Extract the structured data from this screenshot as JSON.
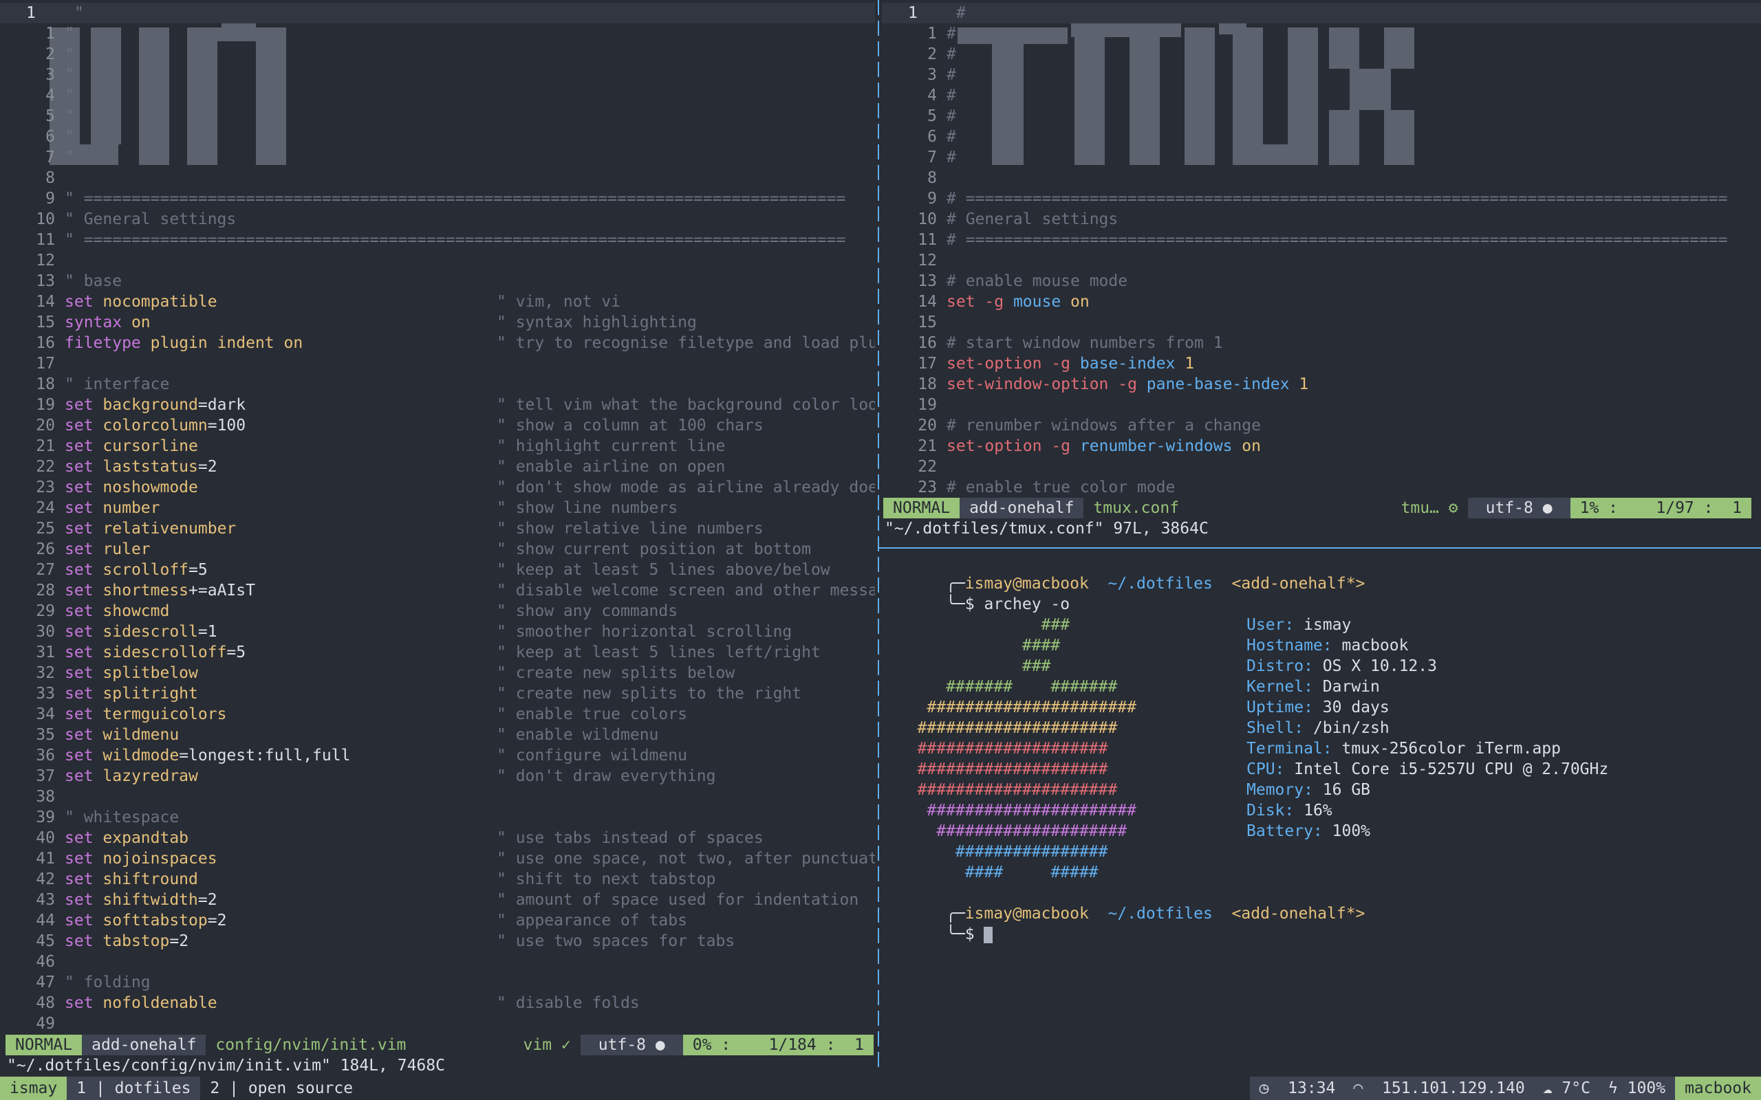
{
  "left_buffer": {
    "current_line": "1",
    "lines": [
      {
        "n": "1",
        "t": "\"",
        "c": "cmt"
      },
      {
        "n": "1",
        "t": "\"",
        "c": "cmt"
      },
      {
        "n": "2",
        "t": "\"",
        "c": "cmt"
      },
      {
        "n": "3",
        "t": "\"",
        "c": "cmt"
      },
      {
        "n": "4",
        "t": "\"",
        "c": "cmt"
      },
      {
        "n": "5",
        "t": "\"",
        "c": "cmt"
      },
      {
        "n": "6",
        "t": "\"",
        "c": "cmt"
      },
      {
        "n": "7",
        "t": "\"",
        "c": "cmt"
      },
      {
        "n": "8",
        "t": "",
        "c": "cmt"
      },
      {
        "n": "9",
        "t": "\" ================================================================================",
        "c": "cmt"
      },
      {
        "n": "10",
        "t": "\" General settings",
        "c": "cmt"
      },
      {
        "n": "11",
        "t": "\" ================================================================================",
        "c": "cmt"
      },
      {
        "n": "12",
        "t": "",
        "c": "cmt"
      },
      {
        "n": "13",
        "t": "\" base",
        "c": "cmt"
      },
      {
        "n": "14",
        "kw": "set",
        "opt": "nocompatible",
        "v": "",
        "cm": "\" vim, not vi"
      },
      {
        "n": "15",
        "kw": "syntax",
        "opt": "on",
        "v": "",
        "cm": "\" syntax highlighting"
      },
      {
        "n": "16",
        "kw": "filetype",
        "opt": "plugin indent on",
        "v": "",
        "cm": "\" try to recognise filetype and load plugins a"
      },
      {
        "n": "17",
        "t": "",
        "c": "cmt"
      },
      {
        "n": "18",
        "t": "\" interface",
        "c": "cmt"
      },
      {
        "n": "19",
        "kw": "set",
        "opt": "background",
        "v": "=dark",
        "cm": "\" tell vim what the background color looks lik"
      },
      {
        "n": "20",
        "kw": "set",
        "opt": "colorcolumn",
        "v": "=100",
        "cm": "\" show a column at 100 chars"
      },
      {
        "n": "21",
        "kw": "set",
        "opt": "cursorline",
        "v": "",
        "cm": "\" highlight current line"
      },
      {
        "n": "22",
        "kw": "set",
        "opt": "laststatus",
        "v": "=2",
        "cm": "\" enable airline on open"
      },
      {
        "n": "23",
        "kw": "set",
        "opt": "noshowmode",
        "v": "",
        "cm": "\" don't show mode as airline already does"
      },
      {
        "n": "24",
        "kw": "set",
        "opt": "number",
        "v": "",
        "cm": "\" show line numbers"
      },
      {
        "n": "25",
        "kw": "set",
        "opt": "relativenumber",
        "v": "",
        "cm": "\" show relative line numbers"
      },
      {
        "n": "26",
        "kw": "set",
        "opt": "ruler",
        "v": "",
        "cm": "\" show current position at bottom"
      },
      {
        "n": "27",
        "kw": "set",
        "opt": "scrolloff",
        "v": "=5",
        "cm": "\" keep at least 5 lines above/below"
      },
      {
        "n": "28",
        "kw": "set",
        "opt": "shortmess",
        "v": "+=aAIsT",
        "cm": "\" disable welcome screen and other messages"
      },
      {
        "n": "29",
        "kw": "set",
        "opt": "showcmd",
        "v": "",
        "cm": "\" show any commands"
      },
      {
        "n": "30",
        "kw": "set",
        "opt": "sidescroll",
        "v": "=1",
        "cm": "\" smoother horizontal scrolling"
      },
      {
        "n": "31",
        "kw": "set",
        "opt": "sidescrolloff",
        "v": "=5",
        "cm": "\" keep at least 5 lines left/right"
      },
      {
        "n": "32",
        "kw": "set",
        "opt": "splitbelow",
        "v": "",
        "cm": "\" create new splits below"
      },
      {
        "n": "33",
        "kw": "set",
        "opt": "splitright",
        "v": "",
        "cm": "\" create new splits to the right"
      },
      {
        "n": "34",
        "kw": "set",
        "opt": "termguicolors",
        "v": "",
        "cm": "\" enable true colors"
      },
      {
        "n": "35",
        "kw": "set",
        "opt": "wildmenu",
        "v": "",
        "cm": "\" enable wildmenu"
      },
      {
        "n": "36",
        "kw": "set",
        "opt": "wildmode",
        "v": "=longest:full,full",
        "cm": "\" configure wildmenu"
      },
      {
        "n": "37",
        "kw": "set",
        "opt": "lazyredraw",
        "v": "",
        "cm": "\" don't draw everything"
      },
      {
        "n": "38",
        "t": "",
        "c": "cmt"
      },
      {
        "n": "39",
        "t": "\" whitespace",
        "c": "cmt"
      },
      {
        "n": "40",
        "kw": "set",
        "opt": "expandtab",
        "v": "",
        "cm": "\" use tabs instead of spaces"
      },
      {
        "n": "41",
        "kw": "set",
        "opt": "nojoinspaces",
        "v": "",
        "cm": "\" use one space, not two, after punctuation"
      },
      {
        "n": "42",
        "kw": "set",
        "opt": "shiftround",
        "v": "",
        "cm": "\" shift to next tabstop"
      },
      {
        "n": "43",
        "kw": "set",
        "opt": "shiftwidth",
        "v": "=2",
        "cm": "\" amount of space used for indentation"
      },
      {
        "n": "44",
        "kw": "set",
        "opt": "softtabstop",
        "v": "=2",
        "cm": "\" appearance of tabs"
      },
      {
        "n": "45",
        "kw": "set",
        "opt": "tabstop",
        "v": "=2",
        "cm": "\" use two spaces for tabs"
      },
      {
        "n": "46",
        "t": "",
        "c": "cmt"
      },
      {
        "n": "47",
        "t": "\" folding",
        "c": "cmt"
      },
      {
        "n": "48",
        "kw": "set",
        "opt": "nofoldenable",
        "v": "",
        "cm": "\" disable folds"
      },
      {
        "n": "49",
        "t": "",
        "c": "cmt"
      }
    ],
    "status": {
      "mode": "NORMAL",
      "branch": "add-onehalf",
      "file": "config/nvim/init.vim",
      "filetype": "vim",
      "encoding": "utf-8",
      "percent": "0% :",
      "position": "1/184 :  1"
    },
    "cmdline": "\"~/.dotfiles/config/nvim/init.vim\" 184L, 7468C"
  },
  "right_buffer": {
    "lines": [
      {
        "n": "1",
        "t": "#",
        "c": "cmt"
      },
      {
        "n": "1",
        "t": "#",
        "c": "cmt"
      },
      {
        "n": "2",
        "t": "#",
        "c": "cmt"
      },
      {
        "n": "3",
        "t": "#",
        "c": "cmt"
      },
      {
        "n": "4",
        "t": "#",
        "c": "cmt"
      },
      {
        "n": "5",
        "t": "#",
        "c": "cmt"
      },
      {
        "n": "6",
        "t": "#",
        "c": "cmt"
      },
      {
        "n": "7",
        "t": "#",
        "c": "cmt"
      },
      {
        "n": "8",
        "t": "",
        "c": "cmt"
      },
      {
        "n": "9",
        "t": "# ================================================================================",
        "c": "cmt"
      },
      {
        "n": "10",
        "t": "# General settings",
        "c": "cmt"
      },
      {
        "n": "11",
        "t": "# ================================================================================",
        "c": "cmt"
      },
      {
        "n": "12",
        "t": "",
        "c": "cmt"
      },
      {
        "n": "13",
        "t": "# enable mouse mode",
        "c": "cmt"
      },
      {
        "n": "14",
        "parts": [
          [
            "set",
            "red"
          ],
          [
            " -g ",
            "red"
          ],
          [
            "mouse",
            "blue"
          ],
          [
            " on",
            "on"
          ]
        ]
      },
      {
        "n": "15",
        "t": "",
        "c": "cmt"
      },
      {
        "n": "16",
        "t": "# start window numbers from 1",
        "c": "cmt"
      },
      {
        "n": "17",
        "parts": [
          [
            "set-option",
            "red"
          ],
          [
            " -g ",
            "red"
          ],
          [
            "base-index",
            "blue"
          ],
          [
            " 1",
            "num"
          ]
        ]
      },
      {
        "n": "18",
        "parts": [
          [
            "set-window-option",
            "red"
          ],
          [
            " -g ",
            "red"
          ],
          [
            "pane-base-index",
            "blue"
          ],
          [
            " 1",
            "num"
          ]
        ]
      },
      {
        "n": "19",
        "t": "",
        "c": "cmt"
      },
      {
        "n": "20",
        "t": "# renumber windows after a change",
        "c": "cmt"
      },
      {
        "n": "21",
        "parts": [
          [
            "set-option",
            "red"
          ],
          [
            " -g ",
            "red"
          ],
          [
            "renumber-windows",
            "blue"
          ],
          [
            " on",
            "on"
          ]
        ]
      },
      {
        "n": "22",
        "t": "",
        "c": "cmt"
      },
      {
        "n": "23",
        "t": "# enable true color mode",
        "c": "cmt"
      }
    ],
    "status": {
      "mode": "NORMAL",
      "branch": "add-onehalf",
      "file": "tmux.conf",
      "filetype": "tmu…",
      "encoding": "utf-8",
      "percent": "1% :",
      "position": "1/97 :  1"
    },
    "cmdline": "\"~/.dotfiles/tmux.conf\" 97L, 3864C"
  },
  "terminal": {
    "prompt_user": "ismay@macbook",
    "prompt_path": "~/.dotfiles",
    "prompt_branch": "<add-onehalf*>",
    "prompt_prefix_top": "╭─",
    "prompt_prefix_bottom": "╰─$ ",
    "command": "archey -o",
    "logo": [
      {
        "t": "                ###",
        "color": "#98c379"
      },
      {
        "t": "              ####",
        "color": "#98c379"
      },
      {
        "t": "              ###",
        "color": "#98c379"
      },
      {
        "t": "      #######    #######",
        "color": "#98c379"
      },
      {
        "t": "    ######################",
        "color": "#e5c07b"
      },
      {
        "t": "   #####################",
        "color": "#e5c07b"
      },
      {
        "t": "   ####################",
        "color": "#e06c75"
      },
      {
        "t": "   ####################",
        "color": "#e06c75"
      },
      {
        "t": "   #####################",
        "color": "#e06c75"
      },
      {
        "t": "    ######################",
        "color": "#c678dd"
      },
      {
        "t": "     ####################",
        "color": "#c678dd"
      },
      {
        "t": "       ################",
        "color": "#61afef"
      },
      {
        "t": "        ####     #####",
        "color": "#61afef"
      }
    ],
    "info": [
      {
        "label": "User:",
        "value": "ismay"
      },
      {
        "label": "Hostname:",
        "value": "macbook"
      },
      {
        "label": "Distro:",
        "value": "OS X 10.12.3"
      },
      {
        "label": "Kernel:",
        "value": "Darwin"
      },
      {
        "label": "Uptime:",
        "value": "30 days"
      },
      {
        "label": "Shell:",
        "value": "/bin/zsh"
      },
      {
        "label": "Terminal:",
        "value": "tmux-256color iTerm.app"
      },
      {
        "label": "CPU:",
        "value": "Intel Core i5-5257U CPU @ 2.70GHz"
      },
      {
        "label": "Memory:",
        "value": "16 GB"
      },
      {
        "label": "Disk:",
        "value": "16%"
      },
      {
        "label": "Battery:",
        "value": "100%"
      }
    ]
  },
  "tmux": {
    "session": "ismay",
    "window1": "1 | dotfiles",
    "window2": "2 | open source",
    "time": "13:34",
    "ip": "151.101.129.140",
    "weather": "7°C",
    "battery": "100%",
    "host": "macbook"
  },
  "colors": {
    "background": "#282c34",
    "accent_green": "#98c379",
    "accent_blue": "#61afef",
    "purple": "#c678dd",
    "red": "#e06c75",
    "yellow": "#e5c07b"
  }
}
